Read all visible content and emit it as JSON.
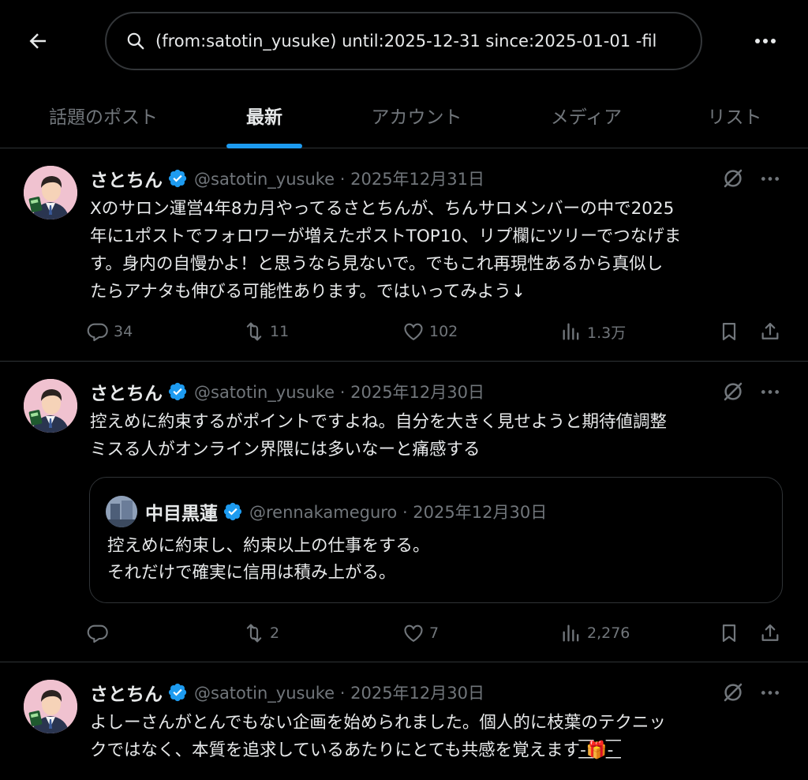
{
  "search": {
    "query": "(from:satotin_yusuke) until:2025-12-31 since:2025-01-01 -fil"
  },
  "tabs": [
    {
      "label": "話題のポスト",
      "active": false
    },
    {
      "label": "最新",
      "active": true
    },
    {
      "label": "アカウント",
      "active": false
    },
    {
      "label": "メディア",
      "active": false
    },
    {
      "label": "リスト",
      "active": false
    }
  ],
  "posts": [
    {
      "name": "さとちん",
      "handle": "@satotin_yusuke · 2025年12月31日",
      "text": "Xのサロン運営4年8カ月やってるさとちんが、ちんサロメンバーの中で2025\n年に1ポストでフォロワーが増えたポストTOP10、リプ欄にツリーでつなげま\nす。身内の自慢かよ！と思うなら見ないで。でもこれ再現性あるから真似し\nたらアナタも伸びる可能性あります。ではいってみよう↓",
      "replies": "34",
      "reposts": "11",
      "likes": "102",
      "views": "1.3万"
    },
    {
      "name": "さとちん",
      "handle": "@satotin_yusuke · 2025年12月30日",
      "text": "控えめに約束するがポイントですよね。自分を大きく見せようと期待値調整\nミスる人がオンライン界隈には多いなーと痛感する",
      "quote": {
        "name": "中目黒蓮",
        "handle": "@rennakameguro · 2025年12月30日",
        "text": "控えめに約束し、約束以上の仕事をする。\nそれだけで確実に信用は積み上がる。"
      },
      "replies": "",
      "reposts": "2",
      "likes": "7",
      "views": "2,276"
    },
    {
      "name": "さとちん",
      "handle": "@satotin_yusuke · 2025年12月30日",
      "text": "よしーさんがとんでもない企画を始められました。個人的に枝葉のテクニッ\nクではなく、本質を追求しているあたりにとても共感を覚えます-͟͟͞͞🎁-͟͟͞͞"
    }
  ],
  "colors": {
    "accent": "#1d9bf0",
    "muted": "#71767b",
    "border": "#2f3336"
  }
}
